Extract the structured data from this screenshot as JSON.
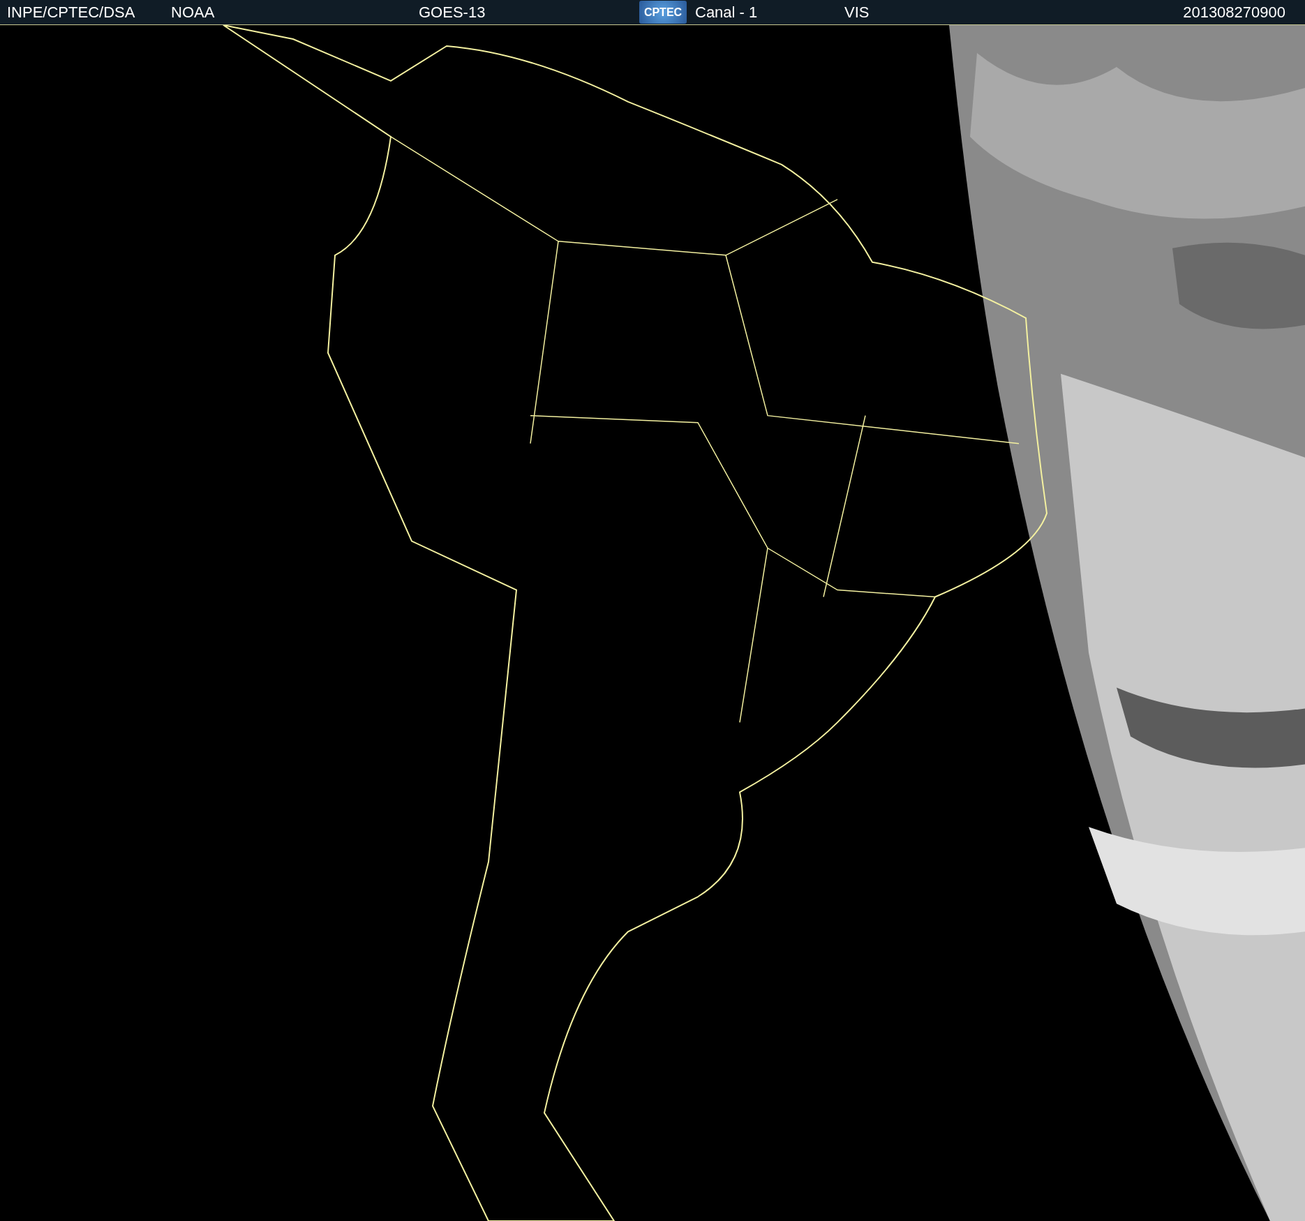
{
  "header": {
    "source": "INPE/CPTEC/DSA",
    "agency": "NOAA",
    "satellite": "GOES-13",
    "logo": "CPTEC",
    "channel": "Canal - 1",
    "band": "VIS",
    "timestamp": "201308270900"
  }
}
